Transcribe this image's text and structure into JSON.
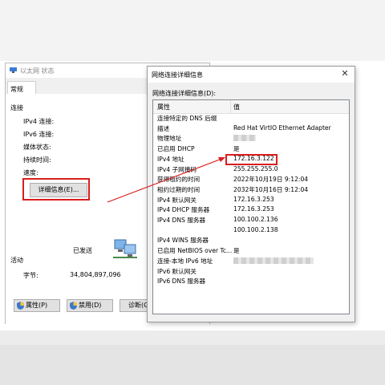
{
  "back_window": {
    "title": "以太网 状态",
    "tab": "常规",
    "connection_section": "连接",
    "rows": [
      "IPv4 连接:",
      "IPv6 连接:",
      "媒体状态:",
      "持续时间:",
      "速度:"
    ],
    "details_button": "详细信息(E)...",
    "activity_section": "活动",
    "sent_label": "已发送",
    "bytes_label": "字节:",
    "bytes_sent": "34,804,897,096",
    "buttons": {
      "properties": "属性(P)",
      "disable": "禁用(D)",
      "diagnose": "诊断(G"
    }
  },
  "details_window": {
    "title": "网络连接详细信息",
    "sublabel": "网络连接详细信息(D):",
    "close_icon": "close-icon",
    "header": {
      "property": "属性",
      "value": "值"
    },
    "rows": [
      {
        "property": "连接特定的 DNS 后缀",
        "value": ""
      },
      {
        "property": "描述",
        "value": "Red Hat VirtIO Ethernet Adapter"
      },
      {
        "property": "物理地址",
        "value": ""
      },
      {
        "property": "已启用 DHCP",
        "value": "是"
      },
      {
        "property": "IPv4 地址",
        "value": "172.16.3.122"
      },
      {
        "property": "IPv4 子网掩码",
        "value": "255.255.255.0"
      },
      {
        "property": "获得租约的时间",
        "value": "2022年10月19日 9:12:04"
      },
      {
        "property": "租约过期的时间",
        "value": "2032年10月16日 9:12:04"
      },
      {
        "property": "IPv4 默认网关",
        "value": "172.16.3.253"
      },
      {
        "property": "IPv4 DHCP 服务器",
        "value": "172.16.3.253"
      },
      {
        "property": "IPv4 DNS 服务器",
        "value": "100.100.2.136"
      },
      {
        "property": "",
        "value": "100.100.2.138"
      },
      {
        "property": "IPv4 WINS 服务器",
        "value": ""
      },
      {
        "property": "已启用 NetBIOS over Tc...",
        "value": "是"
      },
      {
        "property": "连接-本地 IPv6 地址",
        "value": ""
      },
      {
        "property": "IPv6 默认网关",
        "value": ""
      },
      {
        "property": "IPv6 DNS 服务器",
        "value": ""
      }
    ]
  },
  "colors": {
    "highlight": "#d81e1e",
    "window_bg": "#f0f0f0",
    "button_bg": "#e1e1e1"
  }
}
